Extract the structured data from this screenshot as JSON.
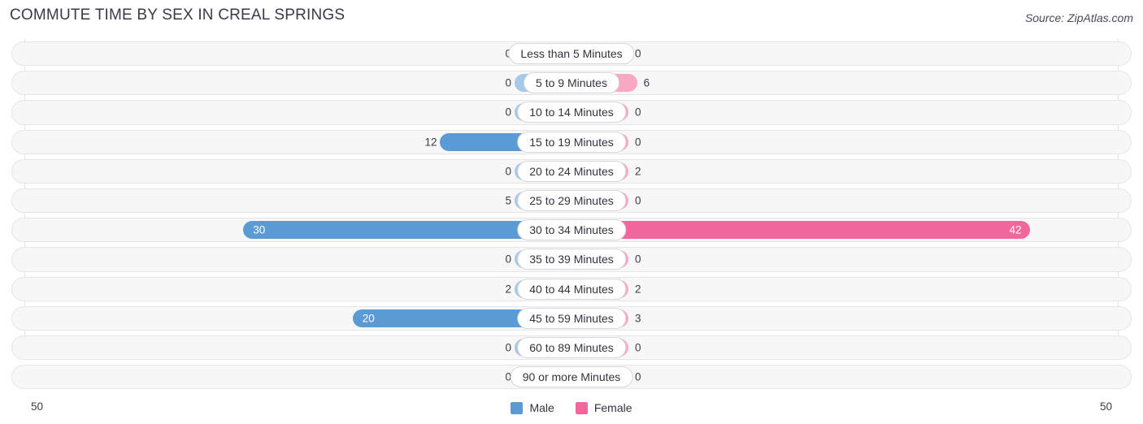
{
  "header": {
    "title": "COMMUTE TIME BY SEX IN CREAL SPRINGS",
    "source": "Source: ZipAtlas.com"
  },
  "axis": {
    "left_max": "50",
    "right_max": "50"
  },
  "legend": {
    "items": [
      {
        "label": "Male",
        "color": "#5b9bd5"
      },
      {
        "label": "Female",
        "color": "#f2679b"
      }
    ]
  },
  "colors": {
    "male_strong": "#5b9bd5",
    "male_light": "#a8c8ea",
    "female_strong": "#f2679b",
    "female_light": "#f9a8c4",
    "track": "#f7f7f7",
    "track_border": "#e6e6e6",
    "gridline": "#e3e3e3"
  },
  "chart_data": {
    "type": "bar",
    "title": "COMMUTE TIME BY SEX IN CREAL SPRINGS",
    "subtitle": "Source: ZipAtlas.com",
    "orientation": "horizontal-diverging",
    "xlabel": "",
    "ylabel": "",
    "xlim": [
      50,
      50
    ],
    "axis_left_max": 50,
    "axis_right_max": 50,
    "grid": true,
    "legend_position": "bottom-center",
    "categories": [
      "Less than 5 Minutes",
      "5 to 9 Minutes",
      "10 to 14 Minutes",
      "15 to 19 Minutes",
      "20 to 24 Minutes",
      "25 to 29 Minutes",
      "30 to 34 Minutes",
      "35 to 39 Minutes",
      "40 to 44 Minutes",
      "45 to 59 Minutes",
      "60 to 89 Minutes",
      "90 or more Minutes"
    ],
    "series": [
      {
        "name": "Male",
        "color": "#5b9bd5",
        "direction": "left",
        "values": [
          0,
          0,
          0,
          12,
          0,
          5,
          30,
          0,
          2,
          20,
          0,
          0
        ]
      },
      {
        "name": "Female",
        "color": "#f2679b",
        "direction": "right",
        "values": [
          0,
          6,
          0,
          0,
          2,
          0,
          42,
          0,
          2,
          3,
          0,
          0
        ]
      }
    ]
  }
}
